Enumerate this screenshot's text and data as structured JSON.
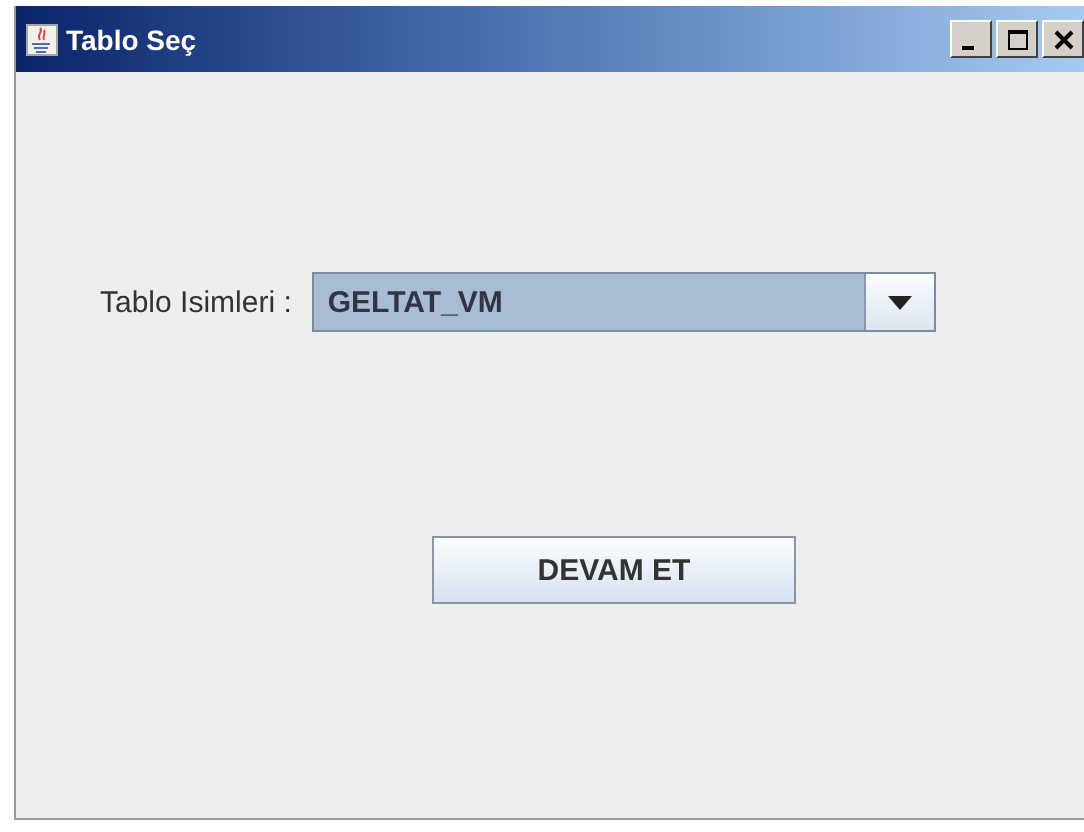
{
  "window": {
    "title": "Tablo Seç"
  },
  "form": {
    "label": "Tablo Isimleri :",
    "combo": {
      "value": "GELTAT_VM"
    }
  },
  "buttons": [
    {
      "label": "DEVAM ET"
    }
  ]
}
